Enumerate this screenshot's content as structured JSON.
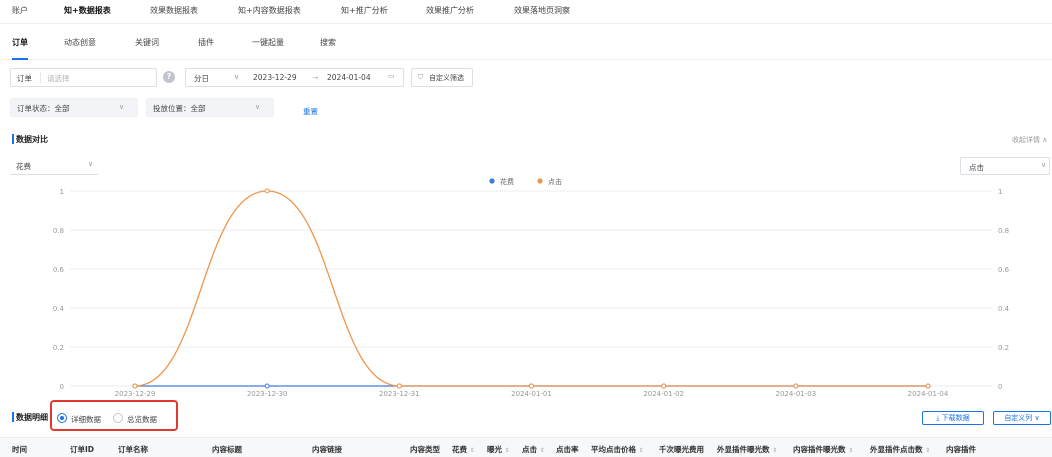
{
  "topnav": {
    "items": [
      "账户",
      "知+数据报表",
      "效果数据报表",
      "知+内容数据报表",
      "知+推广分析",
      "效果推广分析",
      "效果落地页洞察"
    ]
  },
  "subtabs": [
    "订单",
    "动态创意",
    "关键词",
    "插件",
    "一键起量",
    "搜索"
  ],
  "filters": {
    "order_label": "订单",
    "order_placeholder": "请选择",
    "granularity": "分日",
    "date_start": "2023-12-29",
    "date_sep": "→",
    "date_end": "2024-01-04",
    "custom_filter": "自定义筛选",
    "order_status": "订单状态：全部",
    "placement": "投放位置：全部",
    "reset": "重置"
  },
  "compare": {
    "title": "数据对比",
    "collapse": "收起详情",
    "left_metric": "花费",
    "right_metric": "点击"
  },
  "chart_data": {
    "type": "line",
    "x": [
      "2023-12-29",
      "2023-12-30",
      "2023-12-31",
      "2024-01-01",
      "2024-01-02",
      "2024-01-03",
      "2024-01-04"
    ],
    "series": [
      {
        "name": "花费",
        "values": [
          0,
          0,
          0,
          0,
          0,
          0,
          0
        ],
        "color": "#3f7ae3",
        "axis": "left"
      },
      {
        "name": "点击",
        "values": [
          0,
          1,
          0,
          0,
          0,
          0,
          0
        ],
        "color": "#f0954a",
        "axis": "right"
      }
    ],
    "yticks": [
      "0",
      "0.2",
      "0.4",
      "0.6",
      "0.8",
      "1"
    ],
    "ylim": [
      0,
      1
    ],
    "legend_position": "top-center",
    "grid": true
  },
  "detail": {
    "title": "数据明细",
    "opt_detail": "详细数据",
    "opt_overview": "总览数据",
    "download": "下载数据",
    "custom_cols": "自定义列"
  },
  "table": {
    "columns": [
      "时间",
      "订单ID",
      "订单名称",
      "内容标题",
      "内容链接",
      "内容类型",
      "花费",
      "曝光",
      "点击",
      "点击率",
      "平均点击价格",
      "千次曝光费用",
      "外显插件曝光数",
      "内容插件曝光数",
      "外显插件点击数",
      "内容插件"
    ]
  },
  "colors": {
    "accent": "#1a73e8",
    "spend_line": "#3f7ae3",
    "click_line": "#f0954a",
    "highlight_box": "#e0392b"
  }
}
